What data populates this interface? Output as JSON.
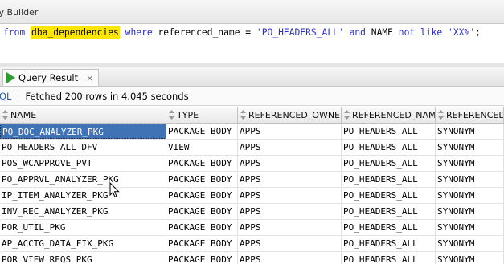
{
  "query_builder_tab": {
    "label": "ry Builder"
  },
  "editor": {
    "sql_parts": [
      {
        "text": "from",
        "kind": "kw"
      },
      {
        "text": " ",
        "kind": "plain"
      },
      {
        "text": "dba_dependencies",
        "kind": "hl"
      },
      {
        "text": " ",
        "kind": "plain"
      },
      {
        "text": "where",
        "kind": "kw"
      },
      {
        "text": " referenced_name = ",
        "kind": "plain"
      },
      {
        "text": "'PO_HEADERS_ALL'",
        "kind": "str"
      },
      {
        "text": " ",
        "kind": "plain"
      },
      {
        "text": "and",
        "kind": "kw"
      },
      {
        "text": " NAME ",
        "kind": "plain"
      },
      {
        "text": "not like",
        "kind": "kw"
      },
      {
        "text": " ",
        "kind": "plain"
      },
      {
        "text": "'XX%'",
        "kind": "str"
      },
      {
        "text": ";",
        "kind": "plain"
      }
    ]
  },
  "results_tab": {
    "label": "Query Result",
    "close": "×",
    "icon": "play-icon"
  },
  "status": {
    "sql_link": "QL",
    "message": "Fetched 200 rows in 4.045 seconds"
  },
  "grid": {
    "columns": [
      "NAME",
      "TYPE",
      "REFERENCED_OWNER",
      "REFERENCED_NAME",
      "REFERENCED_"
    ],
    "rows": [
      [
        "PO_DOC_ANALYZER_PKG",
        "PACKAGE BODY",
        "APPS",
        "PO_HEADERS_ALL",
        "SYNONYM"
      ],
      [
        "PO_HEADERS_ALL_DFV",
        "VIEW",
        "APPS",
        "PO_HEADERS_ALL",
        "SYNONYM"
      ],
      [
        "POS_WCAPPROVE_PVT",
        "PACKAGE BODY",
        "APPS",
        "PO_HEADERS_ALL",
        "SYNONYM"
      ],
      [
        "PO_APPRVL_ANALYZER_PKG",
        "PACKAGE BODY",
        "APPS",
        "PO_HEADERS_ALL",
        "SYNONYM"
      ],
      [
        "IP_ITEM_ANALYZER_PKG",
        "PACKAGE BODY",
        "APPS",
        "PO_HEADERS_ALL",
        "SYNONYM"
      ],
      [
        "INV_REC_ANALYZER_PKG",
        "PACKAGE BODY",
        "APPS",
        "PO_HEADERS_ALL",
        "SYNONYM"
      ],
      [
        "POR_UTIL_PKG",
        "PACKAGE BODY",
        "APPS",
        "PO_HEADERS_ALL",
        "SYNONYM"
      ],
      [
        "AP_ACCTG_DATA_FIX_PKG",
        "PACKAGE BODY",
        "APPS",
        "PO_HEADERS_ALL",
        "SYNONYM"
      ],
      [
        "POR_VIEW_REQS_PKG",
        "PACKAGE BODY",
        "APPS",
        "PO_HEADERS_ALL",
        "SYNONYM"
      ]
    ],
    "selected_row": 0
  },
  "colors": {
    "selection": "#3f73b6",
    "keyword": "#2b2bcf",
    "highlight": "#ffe600",
    "run": "#2e9b2e"
  }
}
